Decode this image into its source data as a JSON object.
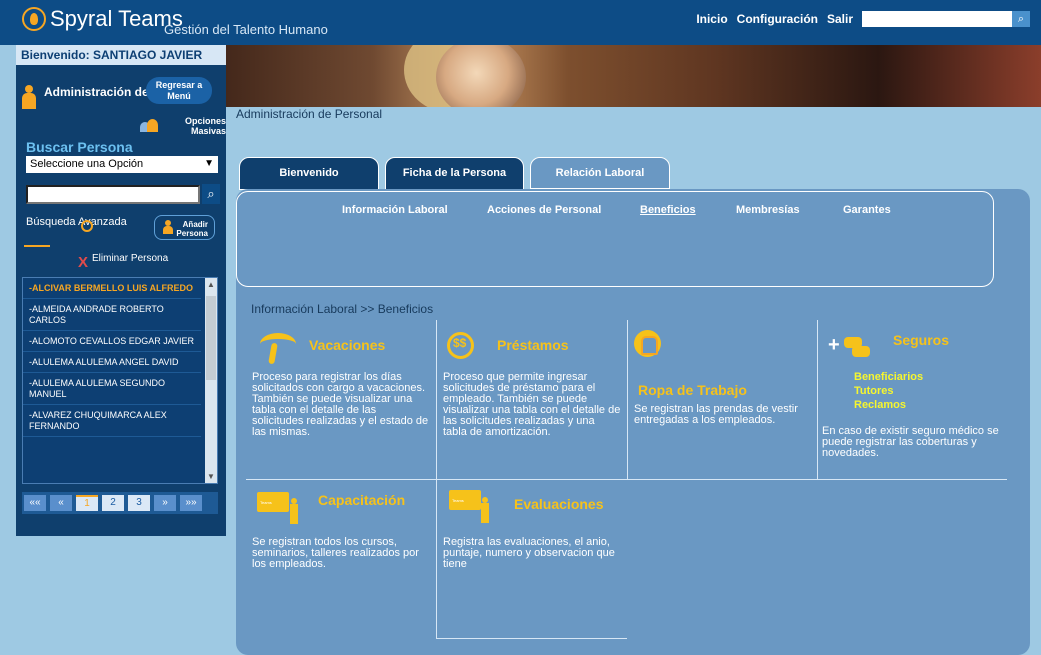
{
  "header": {
    "brand": "Spyral Teams",
    "tagline": "Gestión del Talento Humano",
    "nav": [
      {
        "label": "Inicio"
      },
      {
        "label": "Configuración"
      },
      {
        "label": "Salir"
      }
    ],
    "search_placeholder": ""
  },
  "sidebar": {
    "welcome": "Bienvenido: SANTIAGO JAVIER",
    "section_title": "Administración de Personal",
    "back_button": "Regresar a Menú",
    "mass_options": "Opciones Masivas",
    "search_title": "Buscar Persona",
    "select_value": "Seleccione una Opción",
    "search_input_value": "",
    "advanced_search": "Búsqueda Avanzada",
    "add_person": "Añadir Persona",
    "delete_person": "Eliminar Persona",
    "people": [
      {
        "name": "-ALCIVAR BERMELLO LUIS ALFREDO",
        "selected": true
      },
      {
        "name": "-ALMEIDA ANDRADE ROBERTO CARLOS",
        "selected": false
      },
      {
        "name": "-ALOMOTO CEVALLOS EDGAR JAVIER",
        "selected": false
      },
      {
        "name": "-ALULEMA ALULEMA ANGEL DAVID",
        "selected": false
      },
      {
        "name": "-ALULEMA ALULEMA SEGUNDO MANUEL",
        "selected": false
      },
      {
        "name": "-ALVAREZ CHUQUIMARCA ALEX FERNANDO",
        "selected": false
      }
    ],
    "pager": {
      "first": "««",
      "prev": "«",
      "pages": [
        "1",
        "2",
        "3"
      ],
      "current_page": "1",
      "next": "»",
      "last": "»»"
    }
  },
  "main": {
    "breadcrumb_top": "Administración de Personal",
    "tabs": [
      {
        "label": "Bienvenido"
      },
      {
        "label": "Ficha de la Persona"
      },
      {
        "label": "Relación Laboral"
      }
    ],
    "subtabs": [
      {
        "label": "Información Laboral"
      },
      {
        "label": "Acciones de Personal"
      },
      {
        "label": "Beneficios"
      },
      {
        "label": "Membresías"
      },
      {
        "label": "Garantes"
      }
    ],
    "section_breadcrumb": "Información Laboral >> Beneficios",
    "cards": [
      {
        "title": "Vacaciones",
        "description": "Proceso para registrar los días solicitados con cargo a vacaciones. También se puede visualizar una tabla con el detalle de las solicitudes realizadas y el estado de las mismas."
      },
      {
        "title": "Préstamos",
        "description": "Proceso que permite ingresar solicitudes de préstamo para el empleado. También se puede visualizar una tabla con el detalle de las solicitudes realizadas y una tabla de amortización."
      },
      {
        "title": "Ropa de Trabajo",
        "description": "Se registran las prendas de vestir entregadas a los empleados."
      },
      {
        "title": "Seguros",
        "links": [
          "Beneficiarios",
          "Tutores",
          "Reclamos"
        ],
        "description": "En caso de existir seguro médico se puede registrar las coberturas y novedades."
      },
      {
        "title": "Capacitación",
        "description": "Se registran todos los cursos, seminarios, talleres realizados por los empleados."
      },
      {
        "title": "Evaluaciones",
        "description": "Registra las evaluaciones, el anio, puntaje, numero y observacion que tiene"
      }
    ]
  },
  "colors": {
    "top_bar": "#0d4c86",
    "sidebar": "#0f3f6d",
    "content_panel": "#6a98c3",
    "accent_yellow": "#f6c21a",
    "accent_orange": "#f6a623"
  },
  "icons": [
    "logo-icon",
    "search-icon",
    "person-icon",
    "back-icon",
    "group-icon",
    "magnifier-icon",
    "close-icon",
    "palm-tree-icon",
    "money-icon",
    "jacket-icon",
    "medical-car-icon",
    "presentation-board-icon"
  ]
}
